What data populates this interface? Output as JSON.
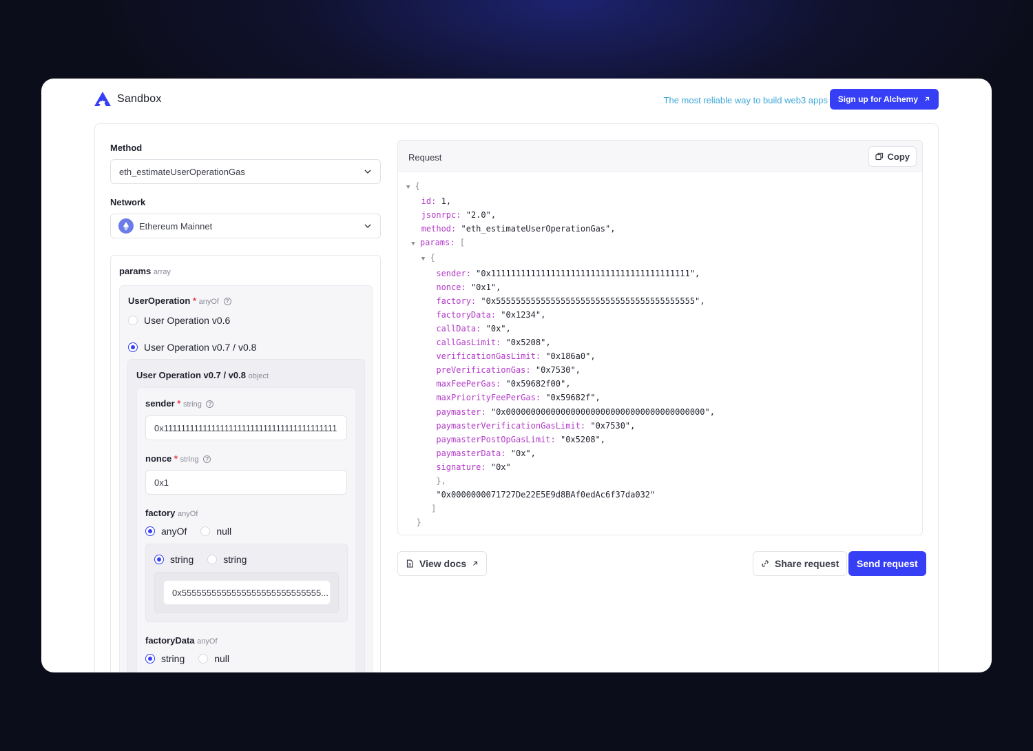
{
  "brand": {
    "name": "Sandbox"
  },
  "header": {
    "tagline": "The most reliable way to build web3 apps",
    "signup_label": "Sign up for Alchemy"
  },
  "method": {
    "label": "Method",
    "value": "eth_estimateUserOperationGas"
  },
  "network": {
    "label": "Network",
    "value": "Ethereum Mainnet"
  },
  "params": {
    "label": "params",
    "type": "array",
    "user_operation": {
      "label": "UserOperation",
      "required": "*",
      "type": "anyOf",
      "options": [
        "User Operation v0.6",
        "User Operation v0.7 / v0.8"
      ],
      "selected_title": "User Operation v0.7 / v0.8",
      "selected_type": "object",
      "sender": {
        "label": "sender",
        "required": "*",
        "type": "string",
        "value": "0x1111111111111111111111111111111111111111"
      },
      "nonce": {
        "label": "nonce",
        "required": "*",
        "type": "string",
        "value": "0x1"
      },
      "factory": {
        "label": "factory",
        "type": "anyOf",
        "options": [
          "anyOf",
          "null"
        ],
        "sub_options": [
          "string",
          "string"
        ],
        "value": "0x5555555555555555555555555555..."
      },
      "factoryData": {
        "label": "factoryData",
        "type": "anyOf",
        "options": [
          "string",
          "null"
        ]
      }
    }
  },
  "request": {
    "title": "Request",
    "copy_label": "Copy",
    "code": {
      "open": "{",
      "id_key": "id:",
      "id_val": "1,",
      "jsonrpc_key": "jsonrpc:",
      "jsonrpc_val": "\"2.0\",",
      "method_key": "method:",
      "method_val": "\"eth_estimateUserOperationGas\",",
      "params_key": "params:",
      "params_open": "[",
      "obj_open": "{",
      "fields": [
        {
          "k": "sender:",
          "v": "\"0x1111111111111111111111111111111111111111\","
        },
        {
          "k": "nonce:",
          "v": "\"0x1\","
        },
        {
          "k": "factory:",
          "v": "\"0x5555555555555555555555555555555555555555\","
        },
        {
          "k": "factoryData:",
          "v": "\"0x1234\","
        },
        {
          "k": "callData:",
          "v": "\"0x\","
        },
        {
          "k": "callGasLimit:",
          "v": "\"0x5208\","
        },
        {
          "k": "verificationGasLimit:",
          "v": "\"0x186a0\","
        },
        {
          "k": "preVerificationGas:",
          "v": "\"0x7530\","
        },
        {
          "k": "maxFeePerGas:",
          "v": "\"0x59682f00\","
        },
        {
          "k": "maxPriorityFeePerGas:",
          "v": "\"0x59682f\","
        },
        {
          "k": "paymaster:",
          "v": "\"0x0000000000000000000000000000000000000000\","
        },
        {
          "k": "paymasterVerificationGasLimit:",
          "v": "\"0x7530\","
        },
        {
          "k": "paymasterPostOpGasLimit:",
          "v": "\"0x5208\","
        },
        {
          "k": "paymasterData:",
          "v": "\"0x\","
        },
        {
          "k": "signature:",
          "v": "\"0x\""
        }
      ],
      "obj_close": "},",
      "entry_point": "\"0x0000000071727De22E5E9d8BAf0edAc6f37da032\"",
      "params_close": "]",
      "close": "}"
    }
  },
  "actions": {
    "view_docs": "View docs",
    "share": "Share request",
    "send": "Send request"
  },
  "colors": {
    "primary": "#363ff5",
    "accent_text": "#3ea7d8",
    "code_key": "#b239c7"
  },
  "icons": [
    "alchemy-logo-icon",
    "chevron-down-icon",
    "ethereum-icon",
    "help-icon",
    "copy-icon",
    "external-link-icon",
    "document-icon",
    "link-icon"
  ]
}
